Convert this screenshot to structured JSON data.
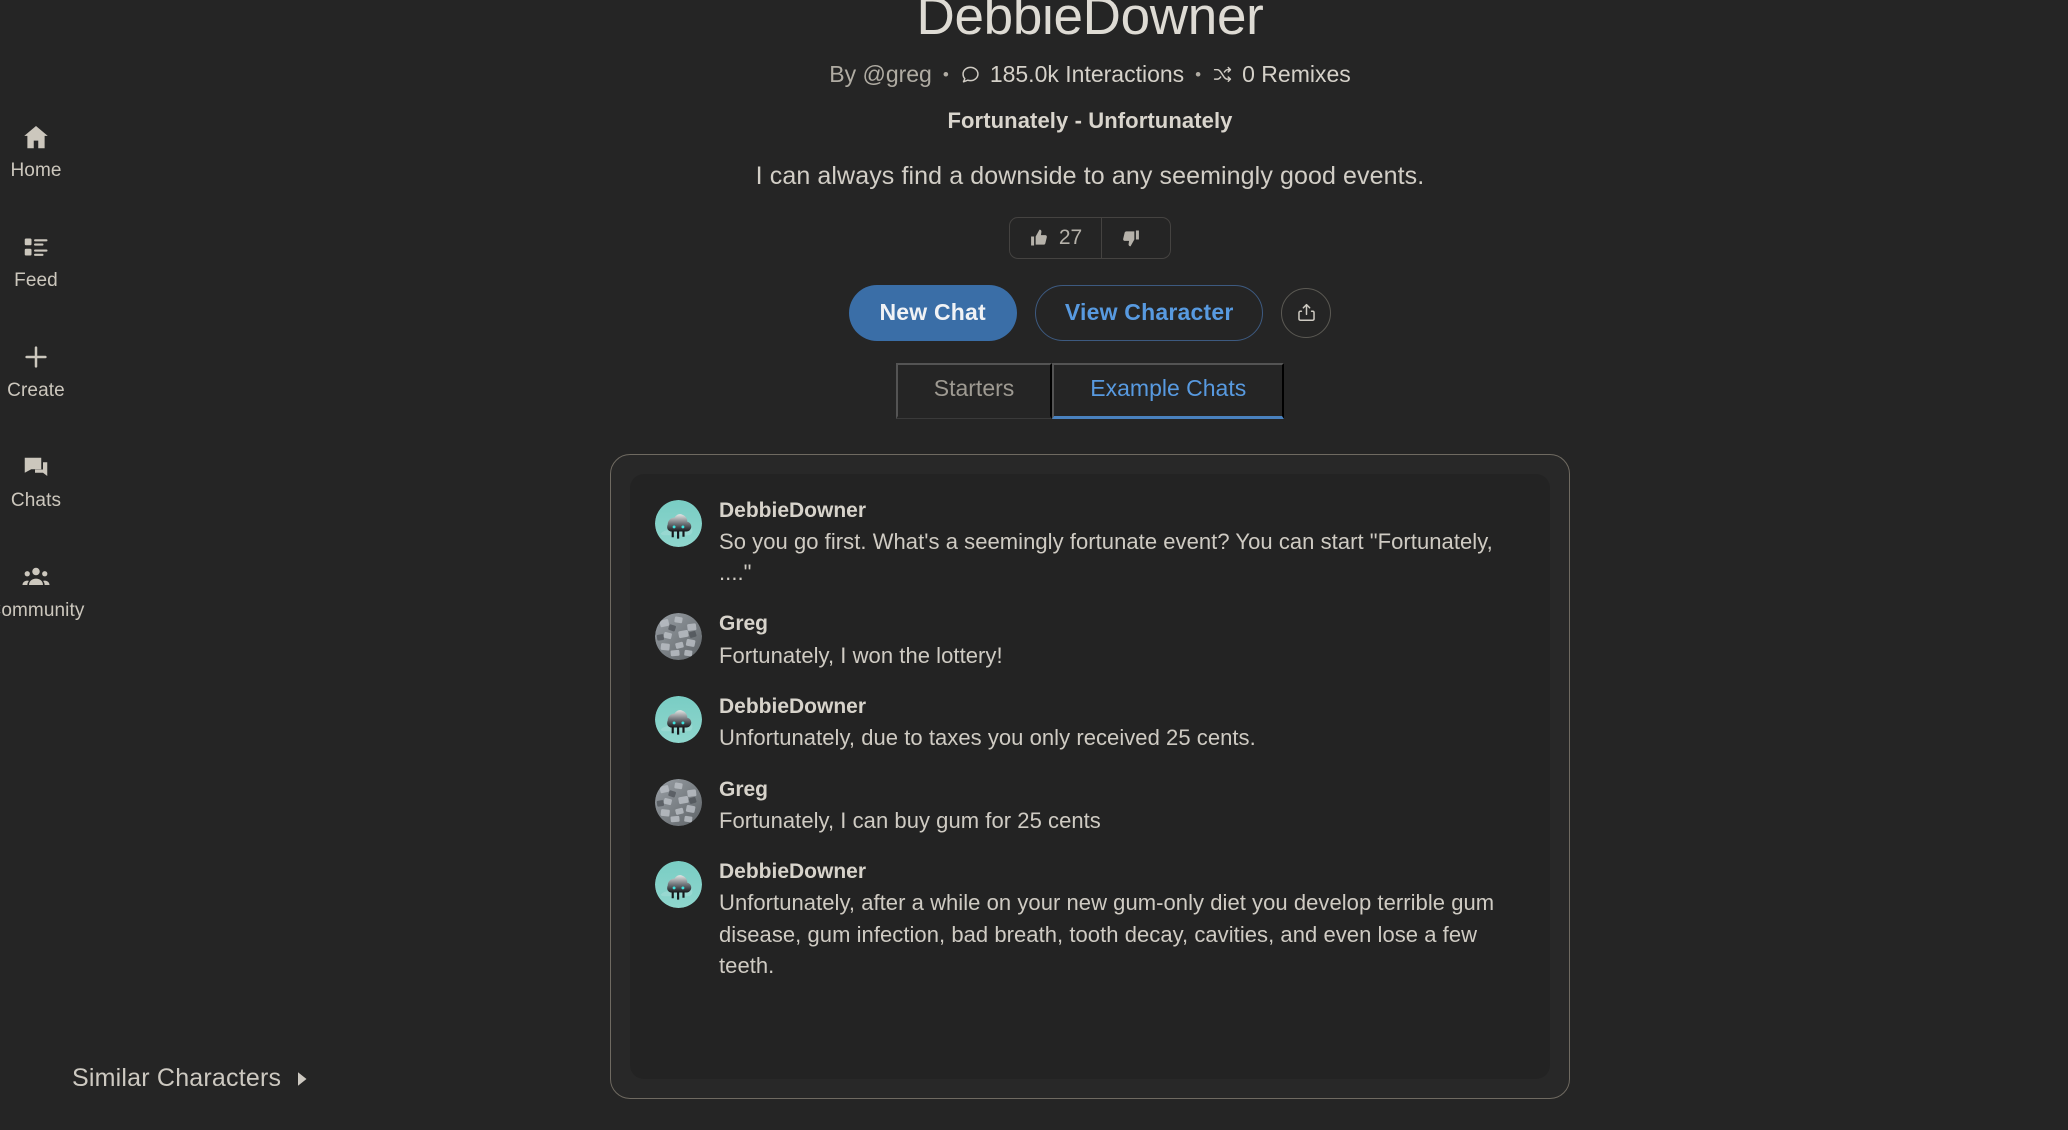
{
  "theme": {
    "page_bg": "#252525",
    "card_bg": "#282828",
    "card_inner_bg": "#232323",
    "card_border": "#6f6a61",
    "text_primary": "#dedbd4",
    "text_secondary": "#b0aca3",
    "accent_blue": "#3a6ea7",
    "accent_blue_text": "#589ae0",
    "avatar_teal": "#63c5bd"
  },
  "sidebar": {
    "items": [
      {
        "label": "Home",
        "icon": "home-icon"
      },
      {
        "label": "Feed",
        "icon": "feed-icon"
      },
      {
        "label": "Create",
        "icon": "plus-icon"
      },
      {
        "label": "Chats",
        "icon": "chat-bubbles-icon"
      },
      {
        "label": "Community",
        "icon": "people-icon"
      }
    ]
  },
  "header": {
    "title": "DebbieDowner",
    "byline": "By @greg",
    "separator": "•",
    "interactions": "185.0k Interactions",
    "interactions_icon": "comment-icon",
    "remixes": "0 Remixes",
    "remixes_icon": "shuffle-icon",
    "tagline": "Fortunately - Unfortunately",
    "description": "I can always find a downside to any seemingly good events."
  },
  "votes": {
    "upvote_icon": "thumbs-up-icon",
    "upvote_count": "27",
    "downvote_icon": "thumbs-down-icon",
    "downvote_count": ""
  },
  "actions": {
    "new_chat": "New Chat",
    "view_character": "View Character",
    "share_icon": "share-icon"
  },
  "tabs": [
    {
      "label": "Starters",
      "active": false
    },
    {
      "label": "Example Chats",
      "active": true
    }
  ],
  "example_chat": {
    "messages": [
      {
        "author": "DebbieDowner",
        "avatar": "storm-cloud-avatar",
        "text": "So you go first. What's a seemingly fortunate event? You can start \"Fortunately, ....\""
      },
      {
        "author": "Greg",
        "avatar": "gray-rubble-avatar",
        "text": "Fortunately, I won the lottery!"
      },
      {
        "author": "DebbieDowner",
        "avatar": "storm-cloud-avatar",
        "text": "Unfortunately, due to taxes you only received 25 cents."
      },
      {
        "author": "Greg",
        "avatar": "gray-rubble-avatar",
        "text": "Fortunately, I can buy gum for 25 cents"
      },
      {
        "author": "DebbieDowner",
        "avatar": "storm-cloud-avatar",
        "text": "Unfortunately, after a while on your new gum-only diet you develop terrible gum disease, gum infection, bad breath, tooth decay, cavities, and even lose a few teeth."
      }
    ]
  },
  "footer": {
    "similar_characters": "Similar Characters",
    "chevron_icon": "chevron-right-icon"
  }
}
